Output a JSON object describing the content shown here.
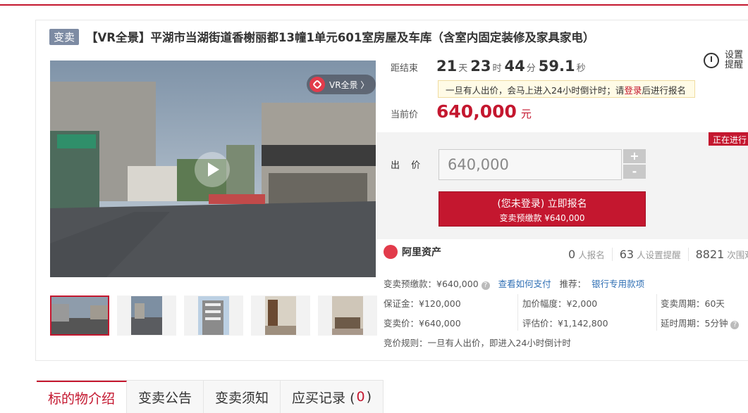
{
  "header": {
    "badge": "变卖",
    "title": "【VR全景】平湖市当湖街道香榭丽都13幢1单元601室房屋及车库（含室内固定装修及家具家电）"
  },
  "gallery": {
    "vr_label": "VR全景 〉",
    "thumbnails": [
      "thumb-1",
      "thumb-2",
      "thumb-3",
      "thumb-4",
      "thumb-5"
    ]
  },
  "countdown": {
    "label": "距结束",
    "days": "21",
    "days_unit": "天",
    "hours": "23",
    "hours_unit": "时",
    "minutes": "44",
    "minutes_unit": "分",
    "seconds": "59.1",
    "seconds_unit": "秒"
  },
  "remind": {
    "label": "设置提醒"
  },
  "notice": {
    "before": "一旦有人出价，会马上进入24小时倒计时；请",
    "link": "登录",
    "after": "后进行报名"
  },
  "current_price": {
    "label": "当前价",
    "value": "640,000",
    "unit": "元"
  },
  "status": "正在进行",
  "bid": {
    "label": "出 价",
    "value": "640,000",
    "plus": "+",
    "minus": "-",
    "signup_line1": "(您未登录) 立即报名",
    "signup_line2": "变卖预缴款 ¥640,000"
  },
  "platform": {
    "name": "阿里资产"
  },
  "stats": [
    {
      "num": "0",
      "unit": "人报名"
    },
    {
      "num": "63",
      "unit": "人设置提醒"
    },
    {
      "num": "8821",
      "unit": "次围观"
    }
  ],
  "details": {
    "deposit_pre": "变卖预缴款：¥640,000",
    "how_pay": "查看如何支付",
    "recommend_label": "推荐：",
    "recommend_link": "银行专用款项",
    "bond": "保证金：¥120,000",
    "increment": "加价幅度：¥2,000",
    "period": "变卖周期：60天",
    "sale_price": "变卖价：¥640,000",
    "appraisal": "评估价：¥1,142,800",
    "delay": "延时周期：5分钟",
    "rule": "竞价规则：一旦有人出价，即进入24小时倒计时"
  },
  "tabs": [
    {
      "label": "标的物介绍"
    },
    {
      "label": "变卖公告"
    },
    {
      "label": "变卖须知"
    },
    {
      "label": "应买记录 (",
      "count": "0",
      "suffix": ")"
    }
  ],
  "colors": {
    "accent": "#c4172f",
    "link": "#2f6fb4"
  }
}
